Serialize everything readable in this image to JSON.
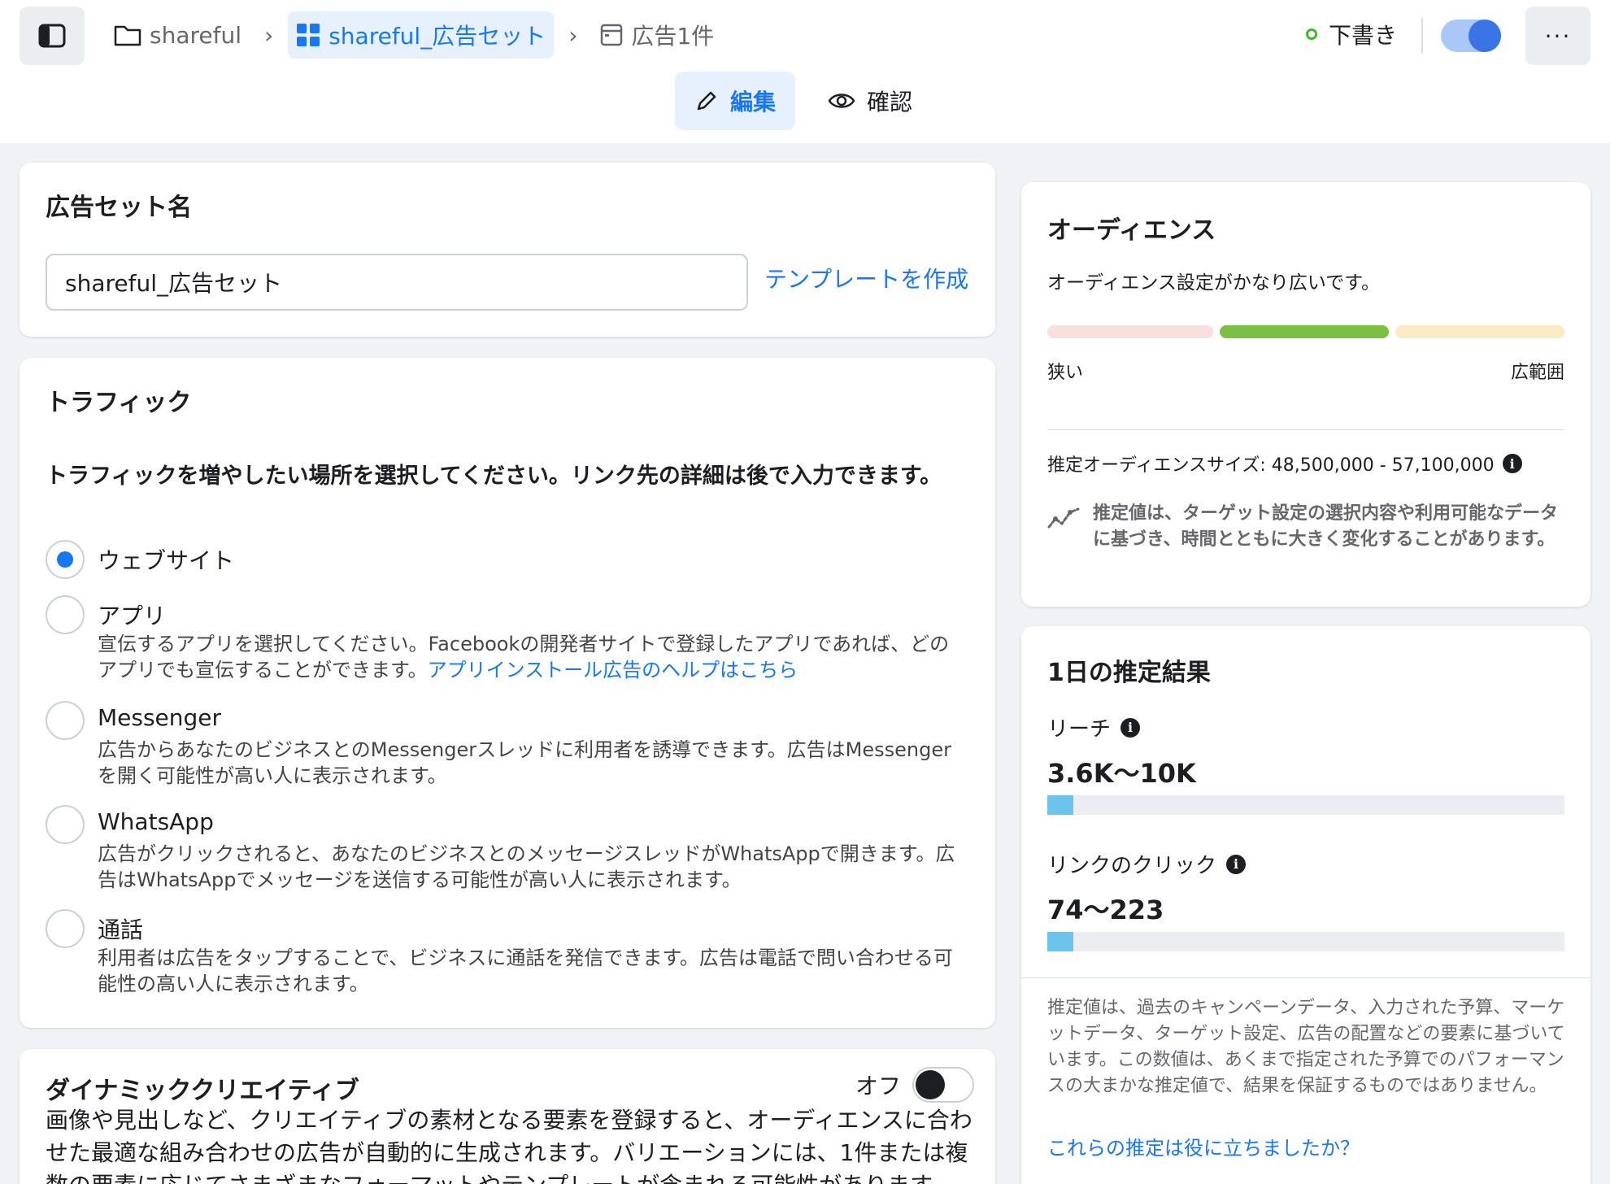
{
  "breadcrumb": {
    "campaign": "shareful",
    "adset": "shareful_広告セット",
    "ads": "広告1件"
  },
  "header": {
    "status": "下書き",
    "more_label": "···"
  },
  "mode_tabs": {
    "edit": "編集",
    "review": "確認"
  },
  "adset_name": {
    "title": "広告セット名",
    "value": "shareful_広告セット",
    "template_link": "テンプレートを作成"
  },
  "traffic": {
    "title": "トラフィック",
    "description": "トラフィックを増やしたい場所を選択してください。リンク先の詳細は後で入力できます。",
    "options": [
      {
        "label": "ウェブサイト",
        "help": "",
        "link": "",
        "checked": true
      },
      {
        "label": "アプリ",
        "help": "宣伝するアプリを選択してください。Facebookの開発者サイトで登録したアプリであれば、どのアプリでも宣伝することができます。",
        "link": "アプリインストール広告のヘルプはこちら",
        "checked": false
      },
      {
        "label": "Messenger",
        "help": "広告からあなたのビジネスとのMessengerスレッドに利用者を誘導できます。広告はMessengerを開く可能性が高い人に表示されます。",
        "link": "",
        "checked": false
      },
      {
        "label": "WhatsApp",
        "help": "広告がクリックされると、あなたのビジネスとのメッセージスレッドがWhatsAppで開きます。広告はWhatsAppでメッセージを送信する可能性が高い人に表示されます。",
        "link": "",
        "checked": false
      },
      {
        "label": "通話",
        "help": "利用者は広告をタップすることで、ビジネスに通話を発信できます。広告は電話で問い合わせる可能性の高い人に表示されます。",
        "link": "",
        "checked": false
      }
    ]
  },
  "dynamic_creative": {
    "title": "ダイナミッククリエイティブ",
    "toggle_label": "オフ",
    "description": "画像や見出しなど、クリエイティブの素材となる要素を登録すると、オーディエンスに合わせた最適な組み合わせの広告が自動的に生成されます。バリエーションには、1件または複数の要素に応じてさまざまなフォーマットやテンプレートが含まれる可能性があります。"
  },
  "audience": {
    "title": "オーディエンス",
    "message": "オーディエンス設定がかなり広いです。",
    "narrow_label": "狭い",
    "broad_label": "広範囲",
    "size_label": "推定オーディエンスサイズ: 48,500,000 - 57,100,000",
    "note": "推定値は、ターゲット設定の選択内容や利用可能なデータに基づき、時間とともに大きく変化することがあります。",
    "colors": {
      "narrow": "#f9e0de",
      "ok": "#7bc043",
      "broad": "#fbeac4"
    }
  },
  "estimate": {
    "title": "1日の推定結果",
    "reach_label": "リーチ",
    "reach_value": "3.6K〜10K",
    "clicks_label": "リンクのクリック",
    "clicks_value": "74〜223",
    "disclaimer": "推定値は、過去のキャンペーンデータ、入力された予算、マーケットデータ、ターゲット設定、広告の配置などの要素に基づいています。この数値は、あくまで指定された予算でのパフォーマンスの大まかな推定値で、結果を保証するものではありません。",
    "feedback_link": "これらの推定は役に立ちましたか？"
  }
}
